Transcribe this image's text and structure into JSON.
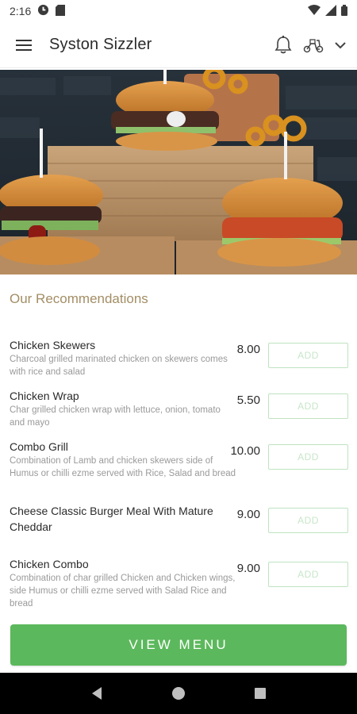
{
  "status_bar": {
    "time": "2:16",
    "icons": [
      "data-saver-icon",
      "sim-card-icon",
      "wifi-icon",
      "signal-icon",
      "battery-icon"
    ]
  },
  "app_bar": {
    "title": "Syston Sizzler",
    "icons": [
      "menu-icon",
      "bell-icon",
      "scooter-icon",
      "chevron-down-icon"
    ]
  },
  "section": {
    "title": "Our Recommendations"
  },
  "items": [
    {
      "name": "Chicken Skewers",
      "description": "Charcoal grilled marinated chicken on skewers comes with rice and salad",
      "price": "8.00",
      "add_label": "ADD"
    },
    {
      "name": "Chicken Wrap",
      "description": "Char grilled chicken wrap with lettuce, onion, tomato and mayo",
      "price": "5.50",
      "add_label": "ADD"
    },
    {
      "name": "Combo Grill",
      "description": "Combination of Lamb and chicken skewers side of Humus or chilli ezme served with Rice, Salad and bread",
      "price": "10.00",
      "add_label": "ADD"
    },
    {
      "name": "Cheese Classic Burger Meal With Mature Cheddar",
      "description": "",
      "price": "9.00",
      "add_label": "ADD"
    },
    {
      "name": "Chicken Combo",
      "description": "Combination of char grilled Chicken and Chicken wings, side Humus or chilli ezme served with Salad Rice and bread",
      "price": "9.00",
      "add_label": "ADD"
    }
  ],
  "cta": {
    "label": "VIEW MENU"
  },
  "colors": {
    "accent_green": "#5cb85c",
    "section_title": "#a38e65",
    "add_text": "#c8e6c9"
  },
  "nav_bar": {
    "icons": [
      "back-icon",
      "home-icon",
      "recents-icon"
    ]
  }
}
